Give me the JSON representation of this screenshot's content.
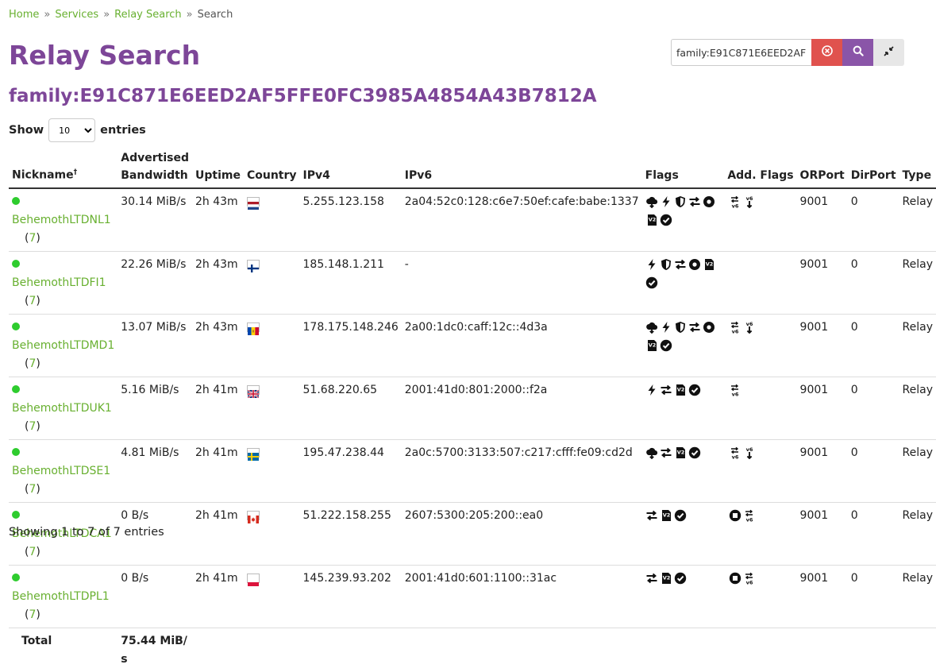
{
  "breadcrumb": [
    "Home",
    "Services",
    "Relay Search",
    "Search"
  ],
  "breadcrumb_sep": "»",
  "title": "Relay Search",
  "search": {
    "value": "family:E91C871E6EED2AF5FFE0FC3985A4854A43B7812A"
  },
  "query_heading": "family:E91C871E6EED2AF5FFE0FC3985A4854A43B7812A",
  "length": {
    "label_before": "Show",
    "selected": "10",
    "label_after": "entries"
  },
  "columns": {
    "nickname": "Nickname",
    "nickname_mark": "†",
    "bandwidth": "Advertised Bandwidth",
    "uptime": "Uptime",
    "country": "Country",
    "ipv4": "IPv4",
    "ipv6": "IPv6",
    "flags": "Flags",
    "addflags": "Add. Flags",
    "orport": "ORPort",
    "dirport": "DirPort",
    "type": "Type"
  },
  "colors": {
    "accent": "#7d4698",
    "link": "#68b030",
    "running": "#2ecc2e"
  },
  "rows": [
    {
      "nickname": "BehemothLTDNL1",
      "family": "7",
      "bandwidth": "30.14 MiB/s",
      "uptime": "2h 43m",
      "country": "nl",
      "ipv4": "5.255.123.158",
      "ipv6": "2a04:52c0:128:c6e7:50ef:cafe:babe:1337",
      "flags": [
        "exit",
        "fast",
        "guard",
        "stable",
        "running",
        "v2dir",
        "valid"
      ],
      "addflags": [
        "reachable-ipv6",
        "exit-ipv6"
      ],
      "orport": "9001",
      "dirport": "0",
      "type": "Relay"
    },
    {
      "nickname": "BehemothLTDFI1",
      "family": "7",
      "bandwidth": "22.26 MiB/s",
      "uptime": "2h 43m",
      "country": "fi",
      "ipv4": "185.148.1.211",
      "ipv6": "-",
      "flags": [
        "fast",
        "guard",
        "stable",
        "running",
        "v2dir",
        "valid"
      ],
      "addflags": [],
      "orport": "9001",
      "dirport": "0",
      "type": "Relay"
    },
    {
      "nickname": "BehemothLTDMD1",
      "family": "7",
      "bandwidth": "13.07 MiB/s",
      "uptime": "2h 43m",
      "country": "md",
      "ipv4": "178.175.148.246",
      "ipv6": "2a00:1dc0:caff:12c::4d3a",
      "flags": [
        "exit",
        "fast",
        "guard",
        "stable",
        "running",
        "v2dir",
        "valid"
      ],
      "addflags": [
        "reachable-ipv6",
        "exit-ipv6"
      ],
      "orport": "9001",
      "dirport": "0",
      "type": "Relay"
    },
    {
      "nickname": "BehemothLTDUK1",
      "family": "7",
      "bandwidth": "5.16 MiB/s",
      "uptime": "2h 41m",
      "country": "gb",
      "ipv4": "51.68.220.65",
      "ipv6": "2001:41d0:801:2000::f2a",
      "flags": [
        "fast",
        "stable",
        "v2dir",
        "valid"
      ],
      "addflags": [
        "reachable-ipv6"
      ],
      "orport": "9001",
      "dirport": "0",
      "type": "Relay"
    },
    {
      "nickname": "BehemothLTDSE1",
      "family": "7",
      "bandwidth": "4.81 MiB/s",
      "uptime": "2h 41m",
      "country": "se",
      "ipv4": "195.47.238.44",
      "ipv6": "2a0c:5700:3133:507:c217:cfff:fe09:cd2d",
      "flags": [
        "exit",
        "stable",
        "v2dir",
        "valid"
      ],
      "addflags": [
        "reachable-ipv6",
        "exit-ipv6"
      ],
      "orport": "9001",
      "dirport": "0",
      "type": "Relay"
    },
    {
      "nickname": "BehemothLTDCA1",
      "family": "7",
      "bandwidth": "0 B/s",
      "uptime": "2h 41m",
      "country": "ca",
      "ipv4": "51.222.158.255",
      "ipv6": "2607:5300:205:200::ea0",
      "flags": [
        "stable",
        "v2dir",
        "valid"
      ],
      "addflags": [
        "not-running",
        "reachable-ipv6"
      ],
      "orport": "9001",
      "dirport": "0",
      "type": "Relay"
    },
    {
      "nickname": "BehemothLTDPL1",
      "family": "7",
      "bandwidth": "0 B/s",
      "uptime": "2h 41m",
      "country": "pl",
      "ipv4": "145.239.93.202",
      "ipv6": "2001:41d0:601:1100::31ac",
      "flags": [
        "stable",
        "v2dir",
        "valid"
      ],
      "addflags": [
        "not-running",
        "reachable-ipv6"
      ],
      "orport": "9001",
      "dirport": "0",
      "type": "Relay"
    }
  ],
  "total": {
    "label": "Total",
    "bandwidth": "75.44 MiB/s"
  },
  "info": "Showing 1 to 7 of 7 entries"
}
